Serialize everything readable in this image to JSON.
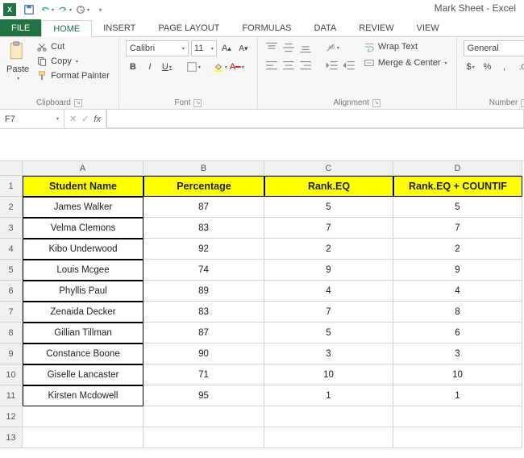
{
  "app": {
    "title": "Mark Sheet - Excel"
  },
  "tabs": {
    "file": "FILE",
    "home": "HOME",
    "insert": "INSERT",
    "pagelayout": "PAGE LAYOUT",
    "formulas": "FORMULAS",
    "data": "DATA",
    "review": "REVIEW",
    "view": "VIEW"
  },
  "clipboard": {
    "paste": "Paste",
    "cut": "Cut",
    "copy": "Copy",
    "fmtpainter": "Format Painter",
    "label": "Clipboard"
  },
  "font": {
    "name": "Calibri",
    "size": "11",
    "label": "Font",
    "bold": "B",
    "italic": "I",
    "underline": "U"
  },
  "alignment": {
    "wrap": "Wrap Text",
    "merge": "Merge & Center",
    "label": "Alignment"
  },
  "number": {
    "format": "General",
    "label": "Number",
    "currency": "$",
    "percent": "%",
    "comma": ",",
    "incdec": "",
    "decdec": ""
  },
  "namebox": {
    "ref": "F7"
  },
  "sheet": {
    "cols": [
      "A",
      "B",
      "C",
      "D"
    ],
    "headers": {
      "A": "Student Name",
      "B": "Percentage",
      "C": "Rank.EQ",
      "D": "Rank.EQ + COUNTIF"
    },
    "rows": [
      {
        "n": "2",
        "A": "James Walker",
        "B": "87",
        "C": "5",
        "D": "5"
      },
      {
        "n": "3",
        "A": "Velma Clemons",
        "B": "83",
        "C": "7",
        "D": "7"
      },
      {
        "n": "4",
        "A": "Kibo Underwood",
        "B": "92",
        "C": "2",
        "D": "2"
      },
      {
        "n": "5",
        "A": "Louis Mcgee",
        "B": "74",
        "C": "9",
        "D": "9"
      },
      {
        "n": "6",
        "A": "Phyllis Paul",
        "B": "89",
        "C": "4",
        "D": "4"
      },
      {
        "n": "7",
        "A": "Zenaida Decker",
        "B": "83",
        "C": "7",
        "D": "8"
      },
      {
        "n": "8",
        "A": "Gillian Tillman",
        "B": "87",
        "C": "5",
        "D": "6"
      },
      {
        "n": "9",
        "A": "Constance Boone",
        "B": "90",
        "C": "3",
        "D": "3"
      },
      {
        "n": "10",
        "A": "Giselle Lancaster",
        "B": "71",
        "C": "10",
        "D": "10"
      },
      {
        "n": "11",
        "A": "Kirsten Mcdowell",
        "B": "95",
        "C": "1",
        "D": "1"
      }
    ],
    "emptyRows": [
      "12",
      "13"
    ]
  }
}
